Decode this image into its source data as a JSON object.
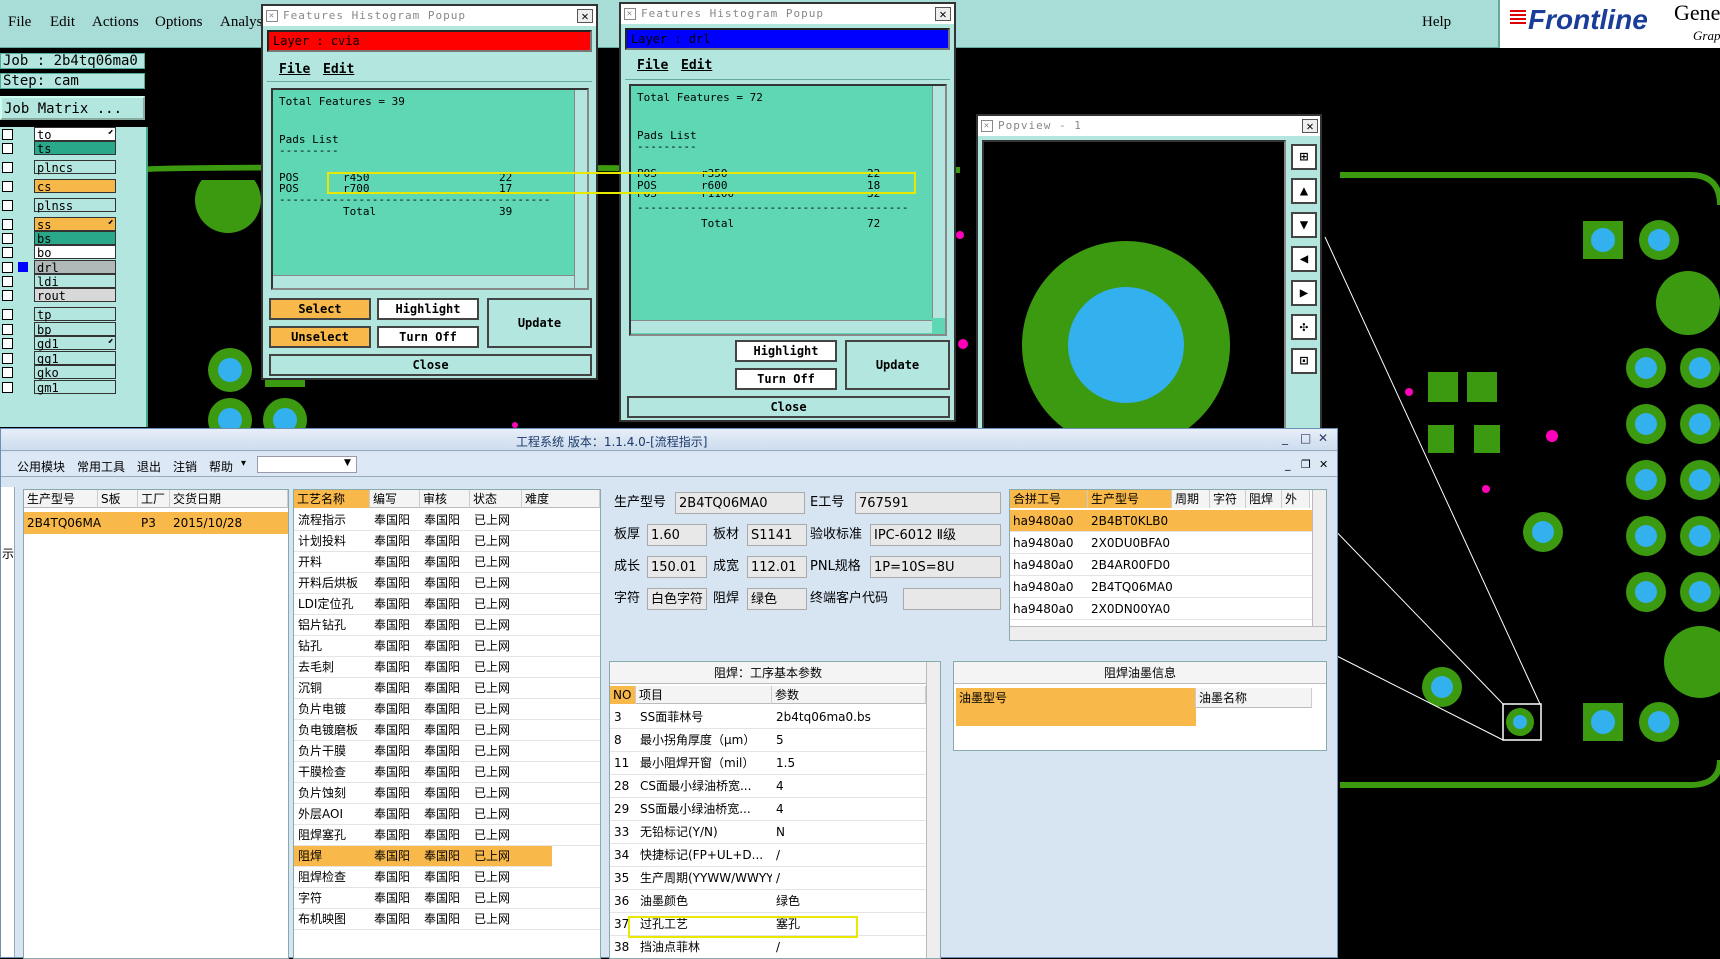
{
  "menubar": {
    "items": [
      "File",
      "Edit",
      "Actions",
      "Options",
      "Analys"
    ],
    "help": "Help",
    "logo": "Frontline",
    "logo_right": "Gene",
    "logo_right2": "Grap"
  },
  "job": {
    "job_label": "Job :  2b4tq06ma0",
    "step_label": "Step:  cam",
    "matrix_button": "Job Matrix ..."
  },
  "layers": [
    {
      "name": "to",
      "color": "#ffffff",
      "mark": "⬋"
    },
    {
      "name": "ts",
      "color": "#2aa88a",
      "mark": ""
    },
    {
      "name": "plncs",
      "color": "#b4e6e0",
      "mark": ""
    },
    {
      "name": "cs",
      "color": "#f7b84a",
      "mark": ""
    },
    {
      "name": "plnss",
      "color": "#b4e6e0",
      "mark": ""
    },
    {
      "name": "ss",
      "color": "#f7b84a",
      "mark": "⬋"
    },
    {
      "name": "bs",
      "color": "#2aa88a",
      "mark": ""
    },
    {
      "name": "bo",
      "color": "#ffffff",
      "mark": ""
    },
    {
      "name": "drl",
      "color": "#b0b8b8",
      "mark": ""
    },
    {
      "name": "ldi",
      "color": "#b4e6e0",
      "mark": ""
    },
    {
      "name": "rout",
      "color": "#d8d8d8",
      "mark": ""
    },
    {
      "name": "tp",
      "color": "#b4e6e0",
      "mark": ""
    },
    {
      "name": "bp",
      "color": "#b4e6e0",
      "mark": ""
    },
    {
      "name": "gd1",
      "color": "#b4e6e0",
      "mark": "⬋"
    },
    {
      "name": "gg1",
      "color": "#b4e6e0",
      "mark": ""
    },
    {
      "name": "gko",
      "color": "#b4e6e0",
      "mark": ""
    },
    {
      "name": "gm1",
      "color": "#b4e6e0",
      "mark": ""
    }
  ],
  "popup1": {
    "title": "Features Histogram Popup",
    "layer_label": "Layer :  cvia",
    "menu": [
      "File",
      "Edit"
    ],
    "total": "Total Features = 39",
    "pads_header": "Pads List",
    "dashes": "---------",
    "rows": [
      {
        "pol": "POS",
        "sym": "r450",
        "count": "22"
      },
      {
        "pol": "POS",
        "sym": "r700",
        "count": "17"
      }
    ],
    "sep": "-----------------------------------------",
    "total_label": "Total",
    "total_value": "39",
    "buttons": {
      "select": "Select",
      "highlight": "Highlight",
      "update": "Update",
      "unselect": "Unselect",
      "turn_off": "Turn Off",
      "close": "Close"
    }
  },
  "popup2": {
    "title": "Features Histogram Popup",
    "layer_label": "Layer :  drl",
    "menu": [
      "File",
      "Edit"
    ],
    "total": "Total Features = 72",
    "pads_header": "Pads List",
    "dashes": "---------",
    "rows": [
      {
        "pol": "POS",
        "sym": "r350",
        "count": "22"
      },
      {
        "pol": "POS",
        "sym": "r600",
        "count": "18"
      },
      {
        "pol": "POS",
        "sym": "r1100",
        "count": "32"
      }
    ],
    "sep": "-----------------------------------------",
    "total_label": "Total",
    "total_value": "72",
    "buttons": {
      "highlight": "Highlight",
      "update": "Update",
      "turn_off": "Turn Off",
      "close": "Close"
    }
  },
  "popview": {
    "title": "Popview - 1"
  },
  "app": {
    "title": "工程系统 版本：1.1.4.0-[流程指示]",
    "menu": [
      "公用模块",
      "常用工具",
      "退出",
      "注销",
      "帮助"
    ],
    "side_tab": "示",
    "jobs_headers": [
      "生产型号",
      "S板",
      "工厂",
      "交货日期"
    ],
    "jobs_rows": [
      [
        "2B4TQ06MA0",
        "",
        "P3",
        "2015/10/28"
      ]
    ],
    "process_headers": [
      "工艺名称",
      "编写",
      "审核",
      "状态",
      "难度"
    ],
    "process_rows": [
      [
        "流程指示",
        "奉国阳",
        "奉国阳",
        "已上网"
      ],
      [
        "计划投料",
        "奉国阳",
        "奉国阳",
        "已上网"
      ],
      [
        "开料",
        "奉国阳",
        "奉国阳",
        "已上网"
      ],
      [
        "开料后烘板",
        "奉国阳",
        "奉国阳",
        "已上网"
      ],
      [
        "LDI定位孔",
        "奉国阳",
        "奉国阳",
        "已上网"
      ],
      [
        "铝片钻孔",
        "奉国阳",
        "奉国阳",
        "已上网"
      ],
      [
        "钻孔",
        "奉国阳",
        "奉国阳",
        "已上网"
      ],
      [
        "去毛刺",
        "奉国阳",
        "奉国阳",
        "已上网"
      ],
      [
        "沉铜",
        "奉国阳",
        "奉国阳",
        "已上网"
      ],
      [
        "负片电镀",
        "奉国阳",
        "奉国阳",
        "已上网"
      ],
      [
        "负电镀磨板",
        "奉国阳",
        "奉国阳",
        "已上网"
      ],
      [
        "负片干膜",
        "奉国阳",
        "奉国阳",
        "已上网"
      ],
      [
        "干膜检查",
        "奉国阳",
        "奉国阳",
        "已上网"
      ],
      [
        "负片蚀刻",
        "奉国阳",
        "奉国阳",
        "已上网"
      ],
      [
        "外层AOI",
        "奉国阳",
        "奉国阳",
        "已上网"
      ],
      [
        "阻焊塞孔",
        "奉国阳",
        "奉国阳",
        "已上网"
      ],
      [
        "阻焊",
        "奉国阳",
        "奉国阳",
        "已上网"
      ],
      [
        "阻焊检查",
        "奉国阳",
        "奉国阳",
        "已上网"
      ],
      [
        "字符",
        "奉国阳",
        "奉国阳",
        "已上网"
      ],
      [
        "布机映图",
        "奉国阳",
        "奉国阳",
        "已上网"
      ]
    ],
    "info": {
      "model_label": "生产型号",
      "model": "2B4TQ06MA0",
      "e_label": "E工号",
      "e_value": "767591",
      "thick_label": "板厚",
      "thick": "1.60",
      "mat_label": "板材",
      "mat": "S1141",
      "std_label": "验收标准",
      "std": "IPC-6012 Ⅱ级",
      "len_label": "成长",
      "len": "150.01",
      "wid_label": "成宽",
      "wid": "112.01",
      "pnl_label": "PNL规格",
      "pnl": "1P=10S=8U",
      "char_label": "字符",
      "char": "白色字符",
      "mask_label": "阻焊",
      "mask": "绿色",
      "cust_label": "终端客户代码",
      "cust": ""
    },
    "combo_headers": [
      "合拼工号",
      "生产型号",
      "周期",
      "字符",
      "阻焊",
      "外"
    ],
    "combo_rows": [
      [
        "ha9480a0",
        "2B4BT0KLB0"
      ],
      [
        "ha9480a0",
        "2X0DU0BFA0"
      ],
      [
        "ha9480a0",
        "2B4AR00FD0"
      ],
      [
        "ha9480a0",
        "2B4TQ06MA0"
      ],
      [
        "ha9480a0",
        "2X0DN00YA0"
      ]
    ],
    "params_title": "阻焊：工序基本参数",
    "params_headers": [
      "NO",
      "项目",
      "参数"
    ],
    "params_rows": [
      [
        "3",
        "SS面菲林号",
        "2b4tq06ma0.bs"
      ],
      [
        "8",
        "最小拐角厚度（μm）",
        "5"
      ],
      [
        "11",
        "最小阻焊开窗（mil）",
        "1.5"
      ],
      [
        "28",
        "CS面最小绿油桥宽...",
        "4"
      ],
      [
        "29",
        "SS面最小绿油桥宽...",
        "4"
      ],
      [
        "33",
        "无铅标记(Y/N)",
        "N"
      ],
      [
        "34",
        "快捷标记(FP+UL+D...",
        "/"
      ],
      [
        "35",
        "生产周期(YYWW/WWYY)",
        "/"
      ],
      [
        "36",
        "油墨颜色",
        "绿色"
      ],
      [
        "37",
        "过孔工艺",
        "塞孔"
      ],
      [
        "38",
        "挡油点菲林",
        "/"
      ]
    ],
    "ink_title": "阻焊油墨信息",
    "ink_headers": [
      "油墨型号",
      "油墨名称"
    ]
  },
  "colors": {
    "pcb_green": "#3c9a10",
    "pcb_blue": "#33b0ee",
    "pcb_magenta": "#ff00bb",
    "accent_orange": "#f9b94a",
    "red_layer": "#ff0000",
    "blue_layer": "#0000ff"
  }
}
